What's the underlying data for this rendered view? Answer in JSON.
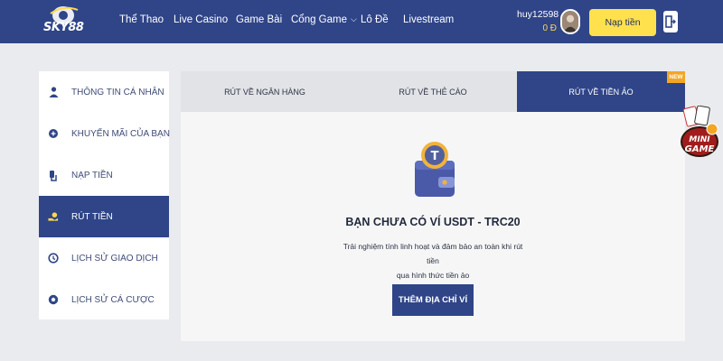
{
  "brand": {
    "logo_text": "SKY88"
  },
  "nav": {
    "items": [
      {
        "label": "Thể Thao"
      },
      {
        "label": "Live Casino"
      },
      {
        "label": "Game Bài"
      },
      {
        "label": "Cổng Game"
      },
      {
        "label": "Lô Đề"
      },
      {
        "label": "Livestream"
      }
    ]
  },
  "user": {
    "username": "huy12598",
    "balance": "0 Đ"
  },
  "header": {
    "deposit_label": "Nạp tiền"
  },
  "sidebar": {
    "items": [
      {
        "label": "THÔNG TIN CÁ NHÂN",
        "icon": "person-icon"
      },
      {
        "label": "KHUYẾN MÃI CỦA BẠN",
        "icon": "gift-icon"
      },
      {
        "label": "NẠP TIỀN",
        "icon": "deposit-hand-icon"
      },
      {
        "label": "RÚT TIỀN",
        "icon": "withdraw-hand-icon",
        "active": true
      },
      {
        "label": "LỊCH SỬ GIAO DỊCH",
        "icon": "history-icon"
      },
      {
        "label": "LỊCH SỬ CÁ CƯỢC",
        "icon": "football-icon"
      }
    ]
  },
  "tabs": {
    "items": [
      {
        "label": "RÚT VỀ NGÂN HÀNG"
      },
      {
        "label": "RÚT VỀ THẺ CÀO"
      },
      {
        "label": "RÚT VỀ TIỀN ẢO",
        "active": true,
        "badge": "NEW"
      }
    ]
  },
  "empty_state": {
    "title": "BẠN CHƯA CÓ VÍ USDT - TRC20",
    "desc_line1": "Trải nghiệm tính linh hoạt và đảm bảo an toàn khi rút tiền",
    "desc_line2": "qua hình thức tiền ảo",
    "button_label": "THÊM ĐỊA CHỈ VÍ",
    "illustration": "usdt-wallet-icon"
  },
  "floating": {
    "minigame_line1": "MINI",
    "minigame_line2": "GAME"
  },
  "colors": {
    "brand_blue": "#2f4588",
    "accent_yellow": "#ffe14d",
    "badge_orange": "#f3a623",
    "page_bg": "#e9ebee"
  }
}
